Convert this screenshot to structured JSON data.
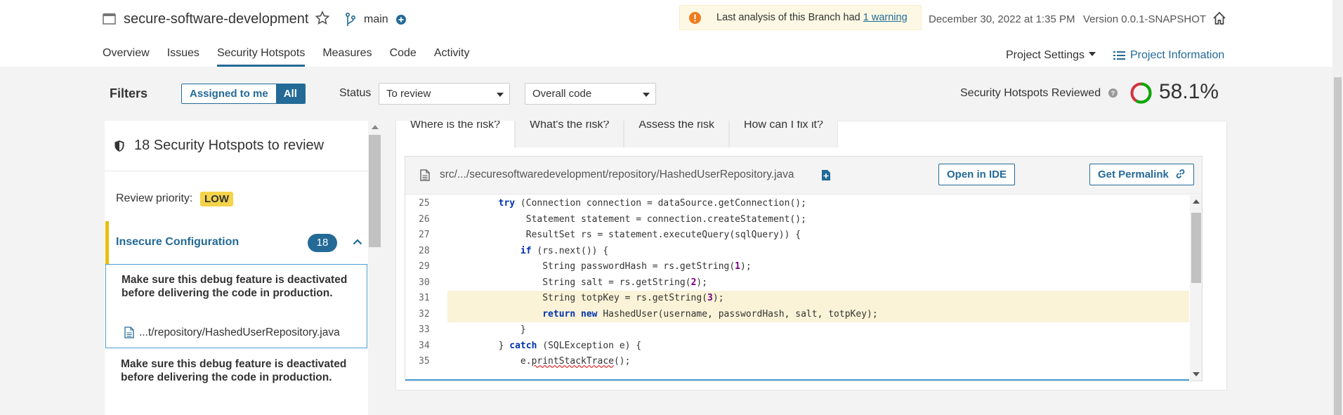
{
  "header": {
    "project_name": "secure-software-development",
    "branch": "main",
    "warning_text": "Last analysis of this Branch had ",
    "warning_link": "1 warning",
    "analysis_date": "December 30, 2022 at 1:35 PM",
    "version": "Version 0.0.1-SNAPSHOT"
  },
  "nav": {
    "items": [
      "Overview",
      "Issues",
      "Security Hotspots",
      "Measures",
      "Code",
      "Activity"
    ],
    "active": "Security Hotspots",
    "project_settings": "Project Settings",
    "project_information": "Project Information"
  },
  "filters": {
    "label": "Filters",
    "assigned_to_me": "Assigned to me",
    "all": "All",
    "status_label": "Status",
    "status_value": "To review",
    "scope_value": "Overall code",
    "reviewed_label": "Security Hotspots Reviewed",
    "reviewed_pct": "58.1%",
    "reviewed_fraction": 0.581
  },
  "sidebar": {
    "hotspots_count": "18 Security Hotspots to review",
    "priority_label": "Review priority:",
    "priority_value": "LOW",
    "category": {
      "name": "Insecure Configuration",
      "count": "18"
    },
    "items": [
      {
        "title": "Make sure this debug feature is deactivated before delivering the code in production.",
        "file": "...t/repository/HashedUserRepository.java"
      },
      {
        "title": "Make sure this debug feature is deactivated before delivering the code in production."
      }
    ]
  },
  "tabs": [
    "Where is the risk?",
    "What's the risk?",
    "Assess the risk",
    "How can I fix it?"
  ],
  "code_view": {
    "file_path": "src/.../securesoftwaredevelopment/repository/HashedUserRepository.java",
    "open_in_ide": "Open in IDE",
    "get_permalink": "Get Permalink",
    "lines": [
      {
        "no": "25",
        "indent": "        ",
        "parts": [
          [
            "kw",
            "try"
          ],
          [
            "t",
            " (Connection connection = dataSource.getConnection();"
          ]
        ]
      },
      {
        "no": "26",
        "indent": "             ",
        "parts": [
          [
            "t",
            "Statement statement = connection.createStatement();"
          ]
        ]
      },
      {
        "no": "27",
        "indent": "             ",
        "parts": [
          [
            "t",
            "ResultSet rs = statement.executeQuery(sqlQuery)) {"
          ]
        ]
      },
      {
        "no": "28",
        "indent": "            ",
        "parts": [
          [
            "kw",
            "if"
          ],
          [
            "t",
            " (rs.next()) {"
          ]
        ]
      },
      {
        "no": "29",
        "indent": "                ",
        "parts": [
          [
            "t",
            "String passwordHash = rs.getString("
          ],
          [
            "num",
            "1"
          ],
          [
            "t",
            ");"
          ]
        ]
      },
      {
        "no": "30",
        "indent": "                ",
        "parts": [
          [
            "t",
            "String salt = rs.getString("
          ],
          [
            "num",
            "2"
          ],
          [
            "t",
            ");"
          ]
        ]
      },
      {
        "no": "31",
        "indent": "                ",
        "hl": true,
        "parts": [
          [
            "t",
            "String totpKey = rs.getString("
          ],
          [
            "num",
            "3"
          ],
          [
            "t",
            ");"
          ]
        ]
      },
      {
        "no": "32",
        "indent": "                ",
        "hl": true,
        "parts": [
          [
            "kw",
            "return"
          ],
          [
            "t",
            " "
          ],
          [
            "kw",
            "new"
          ],
          [
            "t",
            " HashedUser(username, passwordHash, salt, totpKey);"
          ]
        ]
      },
      {
        "no": "33",
        "indent": "            ",
        "parts": [
          [
            "t",
            "}"
          ]
        ]
      },
      {
        "no": "34",
        "indent": "        ",
        "parts": [
          [
            "t",
            "} "
          ],
          [
            "kw",
            "catch"
          ],
          [
            "t",
            " (SQLException e) {"
          ]
        ]
      },
      {
        "no": "35",
        "indent": "            ",
        "parts": [
          [
            "t",
            "e."
          ],
          [
            "sq",
            "printStackTrace"
          ],
          [
            "t",
            "();"
          ]
        ]
      }
    ]
  },
  "colors": {
    "accent": "#236a97",
    "warning": "#eabe06",
    "donut_green": "#00aa00",
    "donut_red": "#d4333f"
  }
}
